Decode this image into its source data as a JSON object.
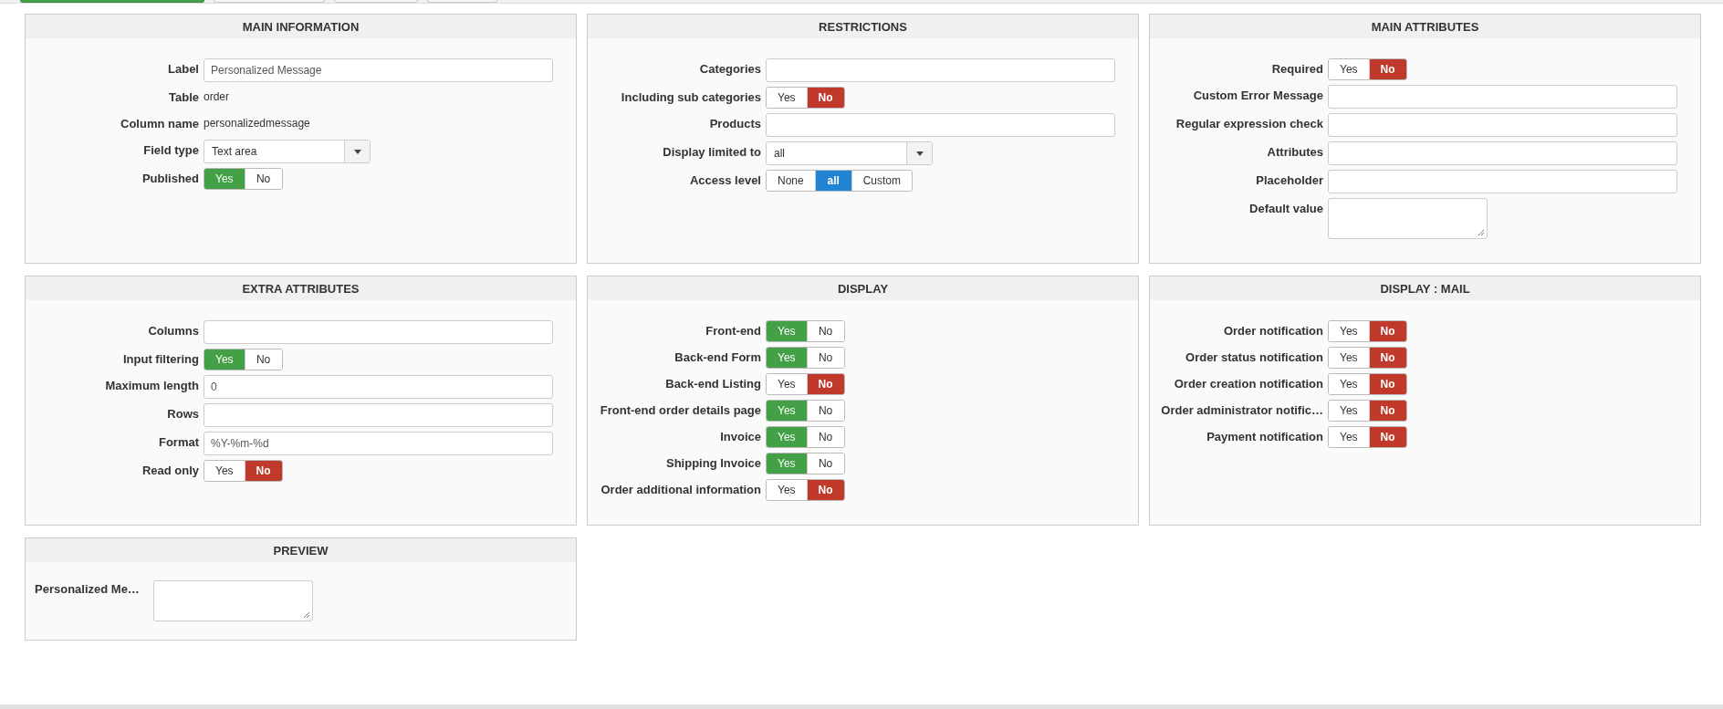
{
  "panels": [
    {
      "title": "MAIN INFORMATION",
      "kind": "form",
      "fields": [
        {
          "label": "Label",
          "kind": "text",
          "value": "Personalized Message"
        },
        {
          "label": "Table",
          "kind": "static",
          "value": "order"
        },
        {
          "label": "Column name",
          "kind": "static",
          "value": "personalizedmessage"
        },
        {
          "label": "Field type",
          "kind": "select",
          "value": "Text area"
        },
        {
          "label": "Published",
          "kind": "toggle",
          "options": [
            {
              "label": "Yes",
              "selected": true
            },
            {
              "label": "No",
              "selected": false
            }
          ]
        }
      ]
    },
    {
      "title": "RESTRICTIONS",
      "kind": "form",
      "fields": [
        {
          "label": "Categories",
          "kind": "text"
        },
        {
          "label": "Including sub categories",
          "kind": "toggle",
          "options": [
            {
              "label": "Yes",
              "selected": false
            },
            {
              "label": "No",
              "selected": true
            }
          ]
        },
        {
          "label": "Products",
          "kind": "text"
        },
        {
          "label": "Display limited to",
          "kind": "select",
          "value": "all"
        },
        {
          "label": "Access level",
          "kind": "toggle",
          "options": [
            {
              "label": "None",
              "selected": false
            },
            {
              "label": "all",
              "selected": true
            },
            {
              "label": "Custom",
              "selected": false
            }
          ]
        }
      ]
    },
    {
      "title": "MAIN ATTRIBUTES",
      "kind": "form",
      "fields": [
        {
          "label": "Required",
          "kind": "toggle",
          "options": [
            {
              "label": "Yes",
              "selected": false
            },
            {
              "label": "No",
              "selected": true
            }
          ]
        },
        {
          "label": "Custom Error Message",
          "kind": "text"
        },
        {
          "label": "Regular expression check",
          "kind": "text"
        },
        {
          "label": "Attributes",
          "kind": "text"
        },
        {
          "label": "Placeholder",
          "kind": "text"
        },
        {
          "label": "Default value",
          "kind": "textarea"
        }
      ]
    },
    {
      "title": "EXTRA ATTRIBUTES",
      "kind": "form",
      "fields": [
        {
          "label": "Columns",
          "kind": "text"
        },
        {
          "label": "Input filtering",
          "kind": "toggle",
          "options": [
            {
              "label": "Yes",
              "selected": true
            },
            {
              "label": "No",
              "selected": false
            }
          ]
        },
        {
          "label": "Maximum length",
          "kind": "text",
          "value": "0"
        },
        {
          "label": "Rows",
          "kind": "text"
        },
        {
          "label": "Format",
          "kind": "text",
          "value": "%Y-%m-%d"
        },
        {
          "label": "Read only",
          "kind": "toggle",
          "options": [
            {
              "label": "Yes",
              "selected": false
            },
            {
              "label": "No",
              "selected": true
            }
          ]
        }
      ]
    },
    {
      "title": "DISPLAY",
      "kind": "form",
      "fields": [
        {
          "label": "Front-end",
          "kind": "toggle",
          "options": [
            {
              "label": "Yes",
              "selected": true
            },
            {
              "label": "No",
              "selected": false
            }
          ]
        },
        {
          "label": "Back-end Form",
          "kind": "toggle",
          "options": [
            {
              "label": "Yes",
              "selected": true
            },
            {
              "label": "No",
              "selected": false
            }
          ]
        },
        {
          "label": "Back-end Listing",
          "kind": "toggle",
          "options": [
            {
              "label": "Yes",
              "selected": false
            },
            {
              "label": "No",
              "selected": true
            }
          ]
        },
        {
          "label": "Front-end order details page",
          "kind": "toggle",
          "options": [
            {
              "label": "Yes",
              "selected": true
            },
            {
              "label": "No",
              "selected": false
            }
          ]
        },
        {
          "label": "Invoice",
          "kind": "toggle",
          "options": [
            {
              "label": "Yes",
              "selected": true
            },
            {
              "label": "No",
              "selected": false
            }
          ]
        },
        {
          "label": "Shipping Invoice",
          "kind": "toggle",
          "options": [
            {
              "label": "Yes",
              "selected": true
            },
            {
              "label": "No",
              "selected": false
            }
          ]
        },
        {
          "label": "Order additional information",
          "kind": "toggle",
          "options": [
            {
              "label": "Yes",
              "selected": false
            },
            {
              "label": "No",
              "selected": true
            }
          ]
        }
      ]
    },
    {
      "title": "DISPLAY : MAIL",
      "kind": "form",
      "fields": [
        {
          "label": "Order notification",
          "kind": "toggle",
          "options": [
            {
              "label": "Yes",
              "selected": false
            },
            {
              "label": "No",
              "selected": true
            }
          ]
        },
        {
          "label": "Order status notification",
          "kind": "toggle",
          "options": [
            {
              "label": "Yes",
              "selected": false
            },
            {
              "label": "No",
              "selected": true
            }
          ]
        },
        {
          "label": "Order creation notification",
          "kind": "toggle",
          "options": [
            {
              "label": "Yes",
              "selected": false
            },
            {
              "label": "No",
              "selected": true
            }
          ]
        },
        {
          "label": "Order administrator notific…",
          "kind": "toggle",
          "options": [
            {
              "label": "Yes",
              "selected": false
            },
            {
              "label": "No",
              "selected": true
            }
          ]
        },
        {
          "label": "Payment notification",
          "kind": "toggle",
          "options": [
            {
              "label": "Yes",
              "selected": false
            },
            {
              "label": "No",
              "selected": true
            }
          ]
        }
      ]
    },
    {
      "title": "PREVIEW",
      "kind": "preview",
      "fields": [
        {
          "label": "Personalized Me…",
          "kind": "textarea"
        }
      ]
    }
  ]
}
